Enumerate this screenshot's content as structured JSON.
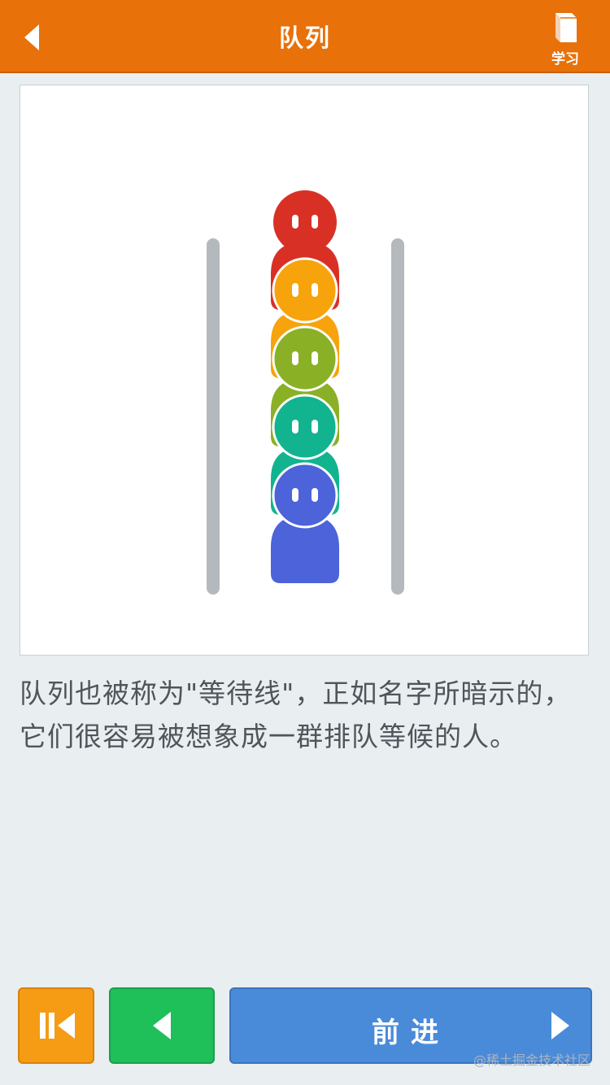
{
  "header": {
    "title": "队列",
    "learn_label": "学习",
    "icons": [
      "back-arrow-icon",
      "book-icon"
    ]
  },
  "illustration": {
    "people_colors": [
      "#d93025",
      "#f7a30c",
      "#8ab026",
      "#12b38f",
      "#4c63d9"
    ]
  },
  "description": "队列也被称为\"等待线\"，正如名字所暗示的，它们很容易被想象成一群排队等候的人。",
  "controls": {
    "next_label": "前进",
    "icons": [
      "skip-to-start-icon",
      "previous-icon",
      "next-icon"
    ]
  },
  "watermark": "@稀土掘金技术社区",
  "colors": {
    "header": "#e8710a",
    "background": "#e9eef0"
  }
}
